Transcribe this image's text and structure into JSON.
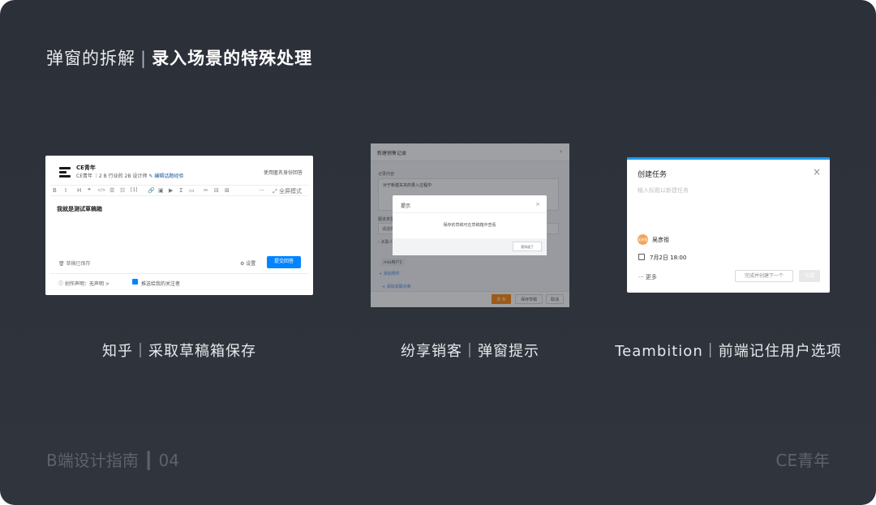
{
  "slide": {
    "title_part1": "弹窗的拆解",
    "title_sep": "|",
    "title_part2": "录入场景的特殊处理",
    "footer_left": "B端设计指南 ┃ 04",
    "footer_right": "CE青年"
  },
  "captions": [
    "知乎｜采取草稿箱保存",
    "纷享销客｜弹窗提示",
    "Teambition｜前端记住用户选项"
  ],
  "zhihu": {
    "user_name": "CE青年",
    "user_desc": "CE青年 ｜2 B 行业的 2B 设计师",
    "edit_link": "✎ 编辑话题经验",
    "anonymous": "使用匿名身份回答",
    "toolbar": [
      "B",
      "I",
      "H",
      "❝",
      "</>",
      "☰",
      "☷",
      "[1]",
      "🔗",
      "▣",
      "▶",
      "Σ",
      "▭",
      "✂",
      "⊟",
      "⊞",
      "···"
    ],
    "fullscreen": "⤢ 全屏模式",
    "body_text": "我就是测试草稿箱",
    "draft_saved": "🗑 草稿已保存",
    "settings": "⚙ 设置",
    "submit": "提交回答",
    "declaration": "ⓘ 创作声明：无声明 >",
    "push": "推送给我的关注者"
  },
  "fenxiang": {
    "header": "新建销售记录",
    "close": "×",
    "label1": "记录内容",
    "content": "对于新建关本的录入过程中",
    "label2": "跟进类型",
    "select": "请选择",
    "misc": "› 关联人",
    "tag": "mia用户1",
    "link1": "+ 添加附件",
    "link2": "+ 添加关联对象",
    "btn_send": "发 布",
    "btn_draft": "保存草稿",
    "btn_cancel": "取消",
    "modal_title": "提示",
    "modal_close": "×",
    "modal_text": "保存的草稿可在草稿箱中查看",
    "modal_button": "我知道了"
  },
  "teambition": {
    "title": "创建任务",
    "close": "×",
    "placeholder": "输入标题以新建任务",
    "avatar": "吴彦祖",
    "assignee": "吴彦祖",
    "date": "7月2日 18:00",
    "more": "··· 更多",
    "create_next": "完成并创建下一个",
    "done": "完成"
  }
}
